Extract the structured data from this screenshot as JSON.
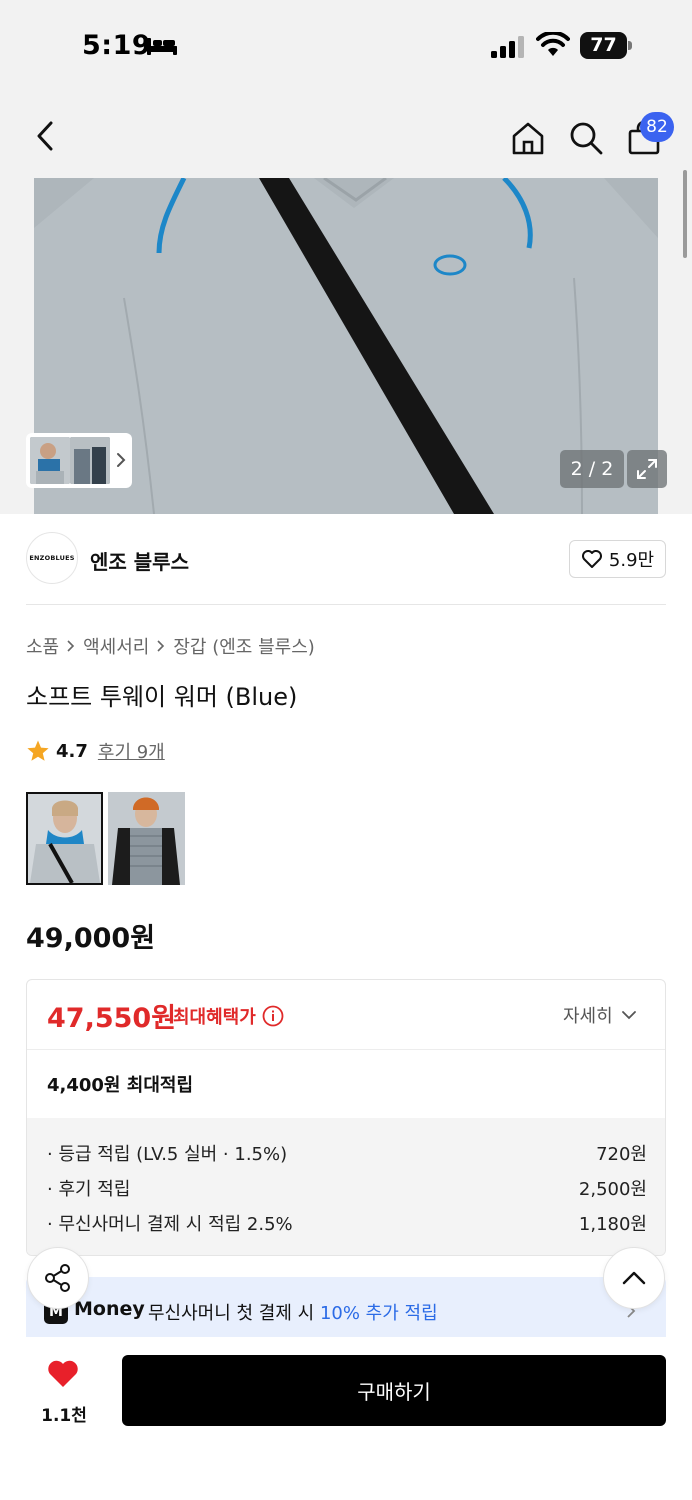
{
  "status_bar": {
    "time": "5:19",
    "battery": "77"
  },
  "nav": {
    "cart_badge": "82"
  },
  "gallery": {
    "counter": "2 / 2"
  },
  "brand": {
    "logo_text": "ENZOBLUES",
    "name": "엔조 블루스",
    "likes": "5.9만"
  },
  "breadcrumb": [
    "소품",
    "액세서리",
    "장갑 (엔조 블루스)"
  ],
  "product": {
    "title": "소프트 투웨이 워머 (Blue)",
    "rating": "4.7",
    "reviews": "후기 9개",
    "price": "49,000원"
  },
  "benefit": {
    "max_price": "47,550원",
    "max_label": "최대혜택가",
    "detail_label": "자세히",
    "points_label": "4,400원 최대적립",
    "items": [
      {
        "label": "· 등급 적립 (LV.5 실버 · 1.5%)",
        "amount": "720원"
      },
      {
        "label": "· 후기 적립",
        "amount": "2,500원"
      },
      {
        "label": "· 무신사머니 결제 시 적립 2.5%",
        "amount": "1,180원"
      }
    ]
  },
  "money_banner": {
    "logo": "M",
    "brand": "Money",
    "text": "무신사머니 첫 결제 시 ",
    "highlight": "10% 추가 적립"
  },
  "bottom": {
    "wish_count": "1.1천",
    "buy_label": "구매하기"
  },
  "colors": {
    "accent_red": "#e02a2a",
    "badge_blue": "#3b63f0",
    "link_blue": "#2b6be6",
    "heart_red": "#e8202a"
  }
}
